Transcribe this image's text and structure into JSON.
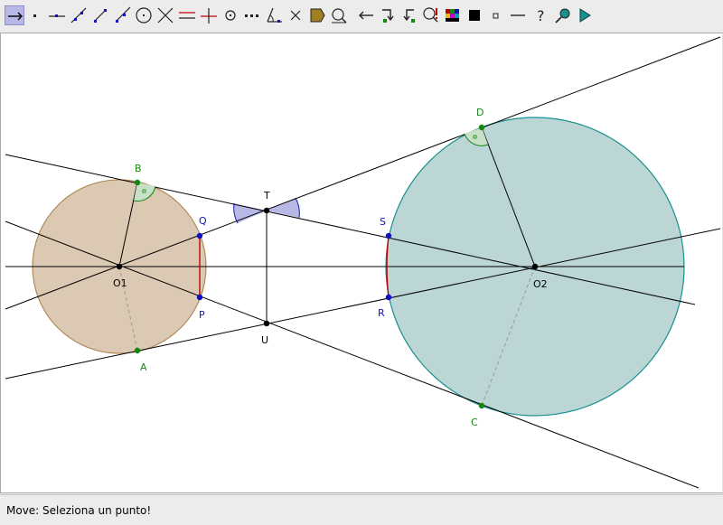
{
  "toolbar": {
    "tools": [
      {
        "icon": "move-arrow-icon"
      },
      {
        "icon": "new-point-icon"
      },
      {
        "icon": "point-on-line-icon"
      },
      {
        "icon": "line-through-two-points-icon"
      },
      {
        "icon": "segment-icon"
      },
      {
        "icon": "ray-icon"
      },
      {
        "icon": "circle-icon"
      },
      {
        "icon": "intersect-icon"
      },
      {
        "icon": "parallel-line-icon"
      },
      {
        "icon": "perpendicular-line-icon"
      },
      {
        "icon": "midpoint-icon"
      },
      {
        "icon": "dotted-line-icon"
      },
      {
        "icon": "angle-icon"
      },
      {
        "icon": "delete-icon"
      },
      {
        "icon": "polygon-icon"
      },
      {
        "icon": "measure-icon"
      },
      {
        "icon": "undo-arrow-icon"
      },
      {
        "icon": "reflect-icon"
      },
      {
        "icon": "rotate-icon"
      },
      {
        "icon": "macro-icon"
      },
      {
        "icon": "color-palette-icon"
      },
      {
        "icon": "fill-black-icon"
      },
      {
        "icon": "small-square-icon"
      },
      {
        "icon": "line-thickness-icon"
      },
      {
        "icon": "help-question-icon"
      },
      {
        "icon": "zoom-icon"
      },
      {
        "icon": "play-triangle-icon"
      }
    ]
  },
  "status": {
    "text": "Move: Seleziona un punto!"
  },
  "colors": {
    "circle1_fill": "#dcc9b3",
    "circle1_stroke": "#b08a58",
    "circle2_fill": "#bcd6d6",
    "circle2_stroke": "#1a9090",
    "point_green": "#118811",
    "point_blue": "#1010c0",
    "point_black": "#000000",
    "label_green": "#118811",
    "label_blue": "#1010c0",
    "chord_red": "#c00000",
    "angle_fill": "#b8b8e6",
    "angle_stroke": "#2020b0",
    "toolbar_bg": "#ececec"
  },
  "diagram": {
    "points": [
      {
        "id": "O1",
        "label": "O1"
      },
      {
        "id": "O2",
        "label": "O2"
      },
      {
        "id": "T",
        "label": "T"
      },
      {
        "id": "U",
        "label": "U"
      },
      {
        "id": "Q",
        "label": "Q"
      },
      {
        "id": "P",
        "label": "P"
      },
      {
        "id": "S",
        "label": "S"
      },
      {
        "id": "R",
        "label": "R"
      },
      {
        "id": "B",
        "label": "B"
      },
      {
        "id": "A",
        "label": "A"
      },
      {
        "id": "D",
        "label": "D"
      },
      {
        "id": "C",
        "label": "C"
      }
    ]
  }
}
